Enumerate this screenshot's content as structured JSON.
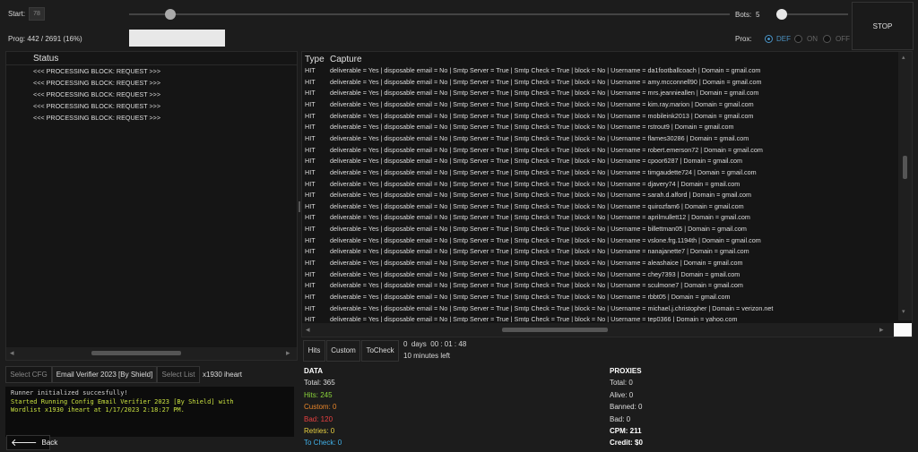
{
  "controls": {
    "start_label": "Start:",
    "start_value": "78",
    "start_fraction": 0.035,
    "prog_label": "Prog: 442 / 2691 (16%)",
    "progress_fraction": 0.16,
    "bots_label": "Bots:",
    "bots_value": "5",
    "prox_label": "Prox:",
    "prox_options": [
      "DEF",
      "ON",
      "OFF"
    ],
    "prox_selected": "DEF",
    "stop_label": "STOP"
  },
  "status_panel": {
    "header": "Status",
    "rows": [
      "<<< PROCESSING BLOCK: REQUEST >>>",
      "<<< PROCESSING BLOCK: REQUEST >>>",
      "<<< PROCESSING BLOCK: REQUEST >>>",
      "<<< PROCESSING BLOCK: REQUEST >>>",
      "<<< PROCESSING BLOCK: REQUEST >>>"
    ]
  },
  "capture_panel": {
    "col_type": "Type",
    "col_capture": "Capture",
    "rows": [
      {
        "type": "HIT",
        "capture": "deliverable = Yes | disposable email = No | Smtp Server = True | Smtp Check = True | block = No | Username = da1footballcoach | Domain = gmail.com"
      },
      {
        "type": "HIT",
        "capture": "deliverable = Yes | disposable email = No | Smtp Server = True | Smtp Check = True | block = No | Username = amy.mcconnell90 | Domain = gmail.com"
      },
      {
        "type": "HIT",
        "capture": "deliverable = Yes | disposable email = No | Smtp Server = True | Smtp Check = True | block = No | Username = mrs.jeannieallen | Domain = gmail.com"
      },
      {
        "type": "HIT",
        "capture": "deliverable = Yes | disposable email = No | Smtp Server = True | Smtp Check = True | block = No | Username = kim.ray.marion | Domain = gmail.com"
      },
      {
        "type": "HIT",
        "capture": "deliverable = Yes | disposable email = No | Smtp Server = True | Smtp Check = True | block = No | Username = mobileink2013 | Domain = gmail.com"
      },
      {
        "type": "HIT",
        "capture": "deliverable = Yes | disposable email = No | Smtp Server = True | Smtp Check = True | block = No | Username = rstrout9 | Domain = gmail.com"
      },
      {
        "type": "HIT",
        "capture": "deliverable = Yes | disposable email = No | Smtp Server = True | Smtp Check = True | block = No | Username = flames30286 | Domain = gmail.com"
      },
      {
        "type": "HIT",
        "capture": "deliverable = Yes | disposable email = No | Smtp Server = True | Smtp Check = True | block = No | Username = robert.emerson72 | Domain = gmail.com"
      },
      {
        "type": "HIT",
        "capture": "deliverable = Yes | disposable email = No | Smtp Server = True | Smtp Check = True | block = No | Username = cpoor6287 | Domain = gmail.com"
      },
      {
        "type": "HIT",
        "capture": "deliverable = Yes | disposable email = No | Smtp Server = True | Smtp Check = True | block = No | Username = timgaudette724 | Domain = gmail.com"
      },
      {
        "type": "HIT",
        "capture": "deliverable = Yes | disposable email = No | Smtp Server = True | Smtp Check = True | block = No | Username = djavery74 | Domain = gmail.com"
      },
      {
        "type": "HIT",
        "capture": "deliverable = Yes | disposable email = No | Smtp Server = True | Smtp Check = True | block = No | Username = sarah.d.alford | Domain = gmail.com"
      },
      {
        "type": "HIT",
        "capture": "deliverable = Yes | disposable email = No | Smtp Server = True | Smtp Check = True | block = No | Username = quirozfam6 | Domain = gmail.com"
      },
      {
        "type": "HIT",
        "capture": "deliverable = Yes | disposable email = No | Smtp Server = True | Smtp Check = True | block = No | Username = aprilmullett12 | Domain = gmail.com"
      },
      {
        "type": "HIT",
        "capture": "deliverable = Yes | disposable email = No | Smtp Server = True | Smtp Check = True | block = No | Username = billettman05 | Domain = gmail.com"
      },
      {
        "type": "HIT",
        "capture": "deliverable = Yes | disposable email = No | Smtp Server = True | Smtp Check = True | block = No | Username = vslone.frg.1194th | Domain = gmail.com"
      },
      {
        "type": "HIT",
        "capture": "deliverable = Yes | disposable email = No | Smtp Server = True | Smtp Check = True | block = No | Username = nanajanette7 | Domain = gmail.com"
      },
      {
        "type": "HIT",
        "capture": "deliverable = Yes | disposable email = No | Smtp Server = True | Smtp Check = True | block = No | Username = aleashaice | Domain = gmail.com"
      },
      {
        "type": "HIT",
        "capture": "deliverable = Yes | disposable email = No | Smtp Server = True | Smtp Check = True | block = No | Username = chey7393 | Domain = gmail.com"
      },
      {
        "type": "HIT",
        "capture": "deliverable = Yes | disposable email = No | Smtp Server = True | Smtp Check = True | block = No | Username = sculmone7 | Domain = gmail.com"
      },
      {
        "type": "HIT",
        "capture": "deliverable = Yes | disposable email = No | Smtp Server = True | Smtp Check = True | block = No | Username = rbbt05 | Domain = gmail.com"
      },
      {
        "type": "HIT",
        "capture": "deliverable = Yes | disposable email = No | Smtp Server = True | Smtp Check = True | block = No | Username = michael.j.christopher | Domain = verizon.net"
      },
      {
        "type": "HIT",
        "capture": "deliverable = Yes | disposable email = No | Smtp Server = True | Smtp Check = True | block = No | Username = tep0366 | Domain = yahoo.com"
      }
    ]
  },
  "tabs": [
    "Hits",
    "Custom",
    "ToCheck"
  ],
  "timer": {
    "elapsed": "0  days  00 : 01 : 48",
    "remaining": "10 minutes left"
  },
  "config_bar": {
    "select_cfg": "Select CFG",
    "cfg_name": "Email Verifier 2023 [By Shield]",
    "select_list": "Select List",
    "list_name": "x1930 iheart"
  },
  "console": {
    "line1": "Runner initialized succesfully!",
    "line2": "Started Running Config Email Verifier 2023 [By Shield] with",
    "line3": "Wordlist x1930 iheart at 1/17/2023 2:18:27 PM."
  },
  "back_label": "Back",
  "data_stats": {
    "title": "DATA",
    "total": "Total:  365",
    "hits": "Hits:  245",
    "custom": "Custom:  0",
    "bad": "Bad:  120",
    "retries": "Retries:  0",
    "tocheck": "To Check:  0"
  },
  "proxy_stats": {
    "title": "PROXIES",
    "total": "Total:   0",
    "alive": "Alive:   0",
    "banned": "Banned:   0",
    "bad": "Bad:   0",
    "cpm": "CPM:   211",
    "credit": "Credit:   $0"
  },
  "colors": {
    "hits": "#8bd43a",
    "custom": "#e8862a",
    "bad": "#e84040",
    "retries": "#e8d040",
    "tocheck": "#40b0e8",
    "console_green": "#c8e040"
  }
}
